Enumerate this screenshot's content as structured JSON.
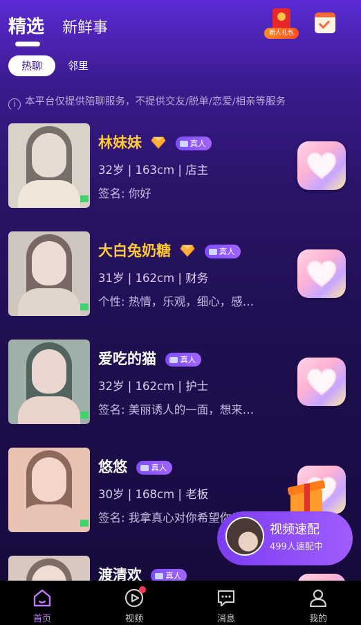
{
  "header": {
    "tab_active": "精选",
    "tab_inactive": "新鲜事",
    "gift_label": "新人礼包",
    "gift_icon": "red-envelope-icon",
    "calendar_icon": "calendar-check-icon"
  },
  "subtabs": {
    "active": "热聊",
    "inactive": "邻里"
  },
  "notice": "本平台仅提供陪聊服务，不提供交友/脱单/恋爱/相亲等服务",
  "users": [
    {
      "name": "林妹妹",
      "vip": true,
      "badge": "真人",
      "meta": "32岁 | 163cm | 店主",
      "sign": "签名: 你好"
    },
    {
      "name": "大白兔奶糖",
      "vip": true,
      "badge": "真人",
      "meta": "31岁 | 162cm | 财务",
      "sign": "个性: 热情，乐观，细心，感…"
    },
    {
      "name": "爱吃的猫",
      "vip": false,
      "badge": "真人",
      "meta": "32岁 | 162cm | 护士",
      "sign": "签名: 美丽诱人的一面，想来…"
    },
    {
      "name": "悠悠",
      "vip": false,
      "badge": "真人",
      "meta": "30岁 | 168cm | 老板",
      "sign": "签名: 我拿真心对你希望你也"
    },
    {
      "name": "渡清欢",
      "vip": false,
      "badge": "真人",
      "meta": "",
      "sign": ""
    }
  ],
  "match": {
    "title": "视频速配",
    "subtitle": "499人速配中"
  },
  "nav": [
    {
      "label": "首页",
      "icon": "home-icon",
      "active": true
    },
    {
      "label": "视频",
      "icon": "video-play-icon",
      "active": false
    },
    {
      "label": "消息",
      "icon": "message-icon",
      "active": false
    },
    {
      "label": "我的",
      "icon": "profile-icon",
      "active": false
    }
  ],
  "colors": {
    "accent": "#c27bff",
    "gold_name": "#ffc93a",
    "badge": "#7c4dff"
  }
}
